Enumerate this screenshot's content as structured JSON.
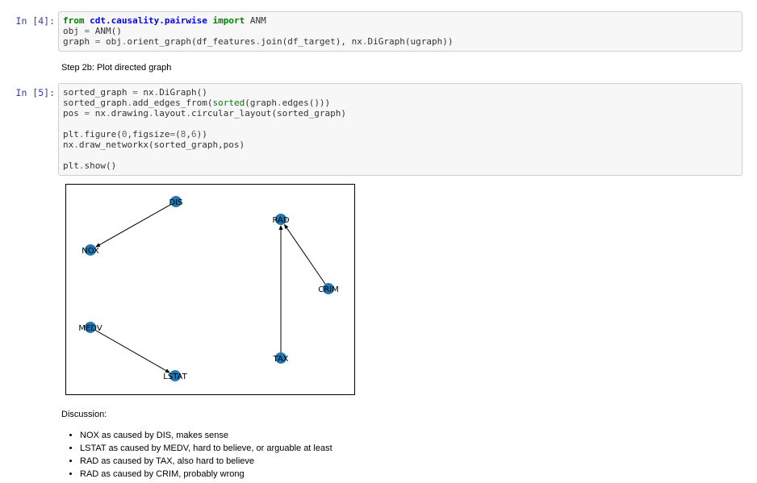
{
  "cells": [
    {
      "prompt": "In [4]:",
      "lines": [
        [
          {
            "t": "from",
            "c": "kw"
          },
          {
            "t": " "
          },
          {
            "t": "cdt.causality.pairwise",
            "c": "ns"
          },
          {
            "t": " "
          },
          {
            "t": "import",
            "c": "kw"
          },
          {
            "t": " ANM"
          }
        ],
        [
          {
            "t": "obj "
          },
          {
            "t": "=",
            "c": "op"
          },
          {
            "t": " ANM()"
          }
        ],
        [
          {
            "t": "graph "
          },
          {
            "t": "=",
            "c": "op"
          },
          {
            "t": " obj"
          },
          {
            "t": ".",
            "c": "op"
          },
          {
            "t": "orient_graph(df_features"
          },
          {
            "t": ".",
            "c": "op"
          },
          {
            "t": "join(df_target), nx"
          },
          {
            "t": ".",
            "c": "op"
          },
          {
            "t": "DiGraph(ugraph))"
          }
        ]
      ]
    },
    {
      "prompt": "In [5]:",
      "lines": [
        [
          {
            "t": "sorted_graph "
          },
          {
            "t": "=",
            "c": "op"
          },
          {
            "t": " nx"
          },
          {
            "t": ".",
            "c": "op"
          },
          {
            "t": "DiGraph()"
          }
        ],
        [
          {
            "t": "sorted_graph"
          },
          {
            "t": ".",
            "c": "op"
          },
          {
            "t": "add_edges_from("
          },
          {
            "t": "sorted",
            "c": "bi"
          },
          {
            "t": "(graph"
          },
          {
            "t": ".",
            "c": "op"
          },
          {
            "t": "edges()))"
          }
        ],
        [
          {
            "t": "pos "
          },
          {
            "t": "=",
            "c": "op"
          },
          {
            "t": " nx"
          },
          {
            "t": ".",
            "c": "op"
          },
          {
            "t": "drawing"
          },
          {
            "t": ".",
            "c": "op"
          },
          {
            "t": "layout"
          },
          {
            "t": ".",
            "c": "op"
          },
          {
            "t": "circular_layout(sorted_graph)"
          }
        ],
        [
          {
            "t": ""
          }
        ],
        [
          {
            "t": "plt"
          },
          {
            "t": ".",
            "c": "op"
          },
          {
            "t": "figure("
          },
          {
            "t": "0",
            "c": "num"
          },
          {
            "t": ",figsize"
          },
          {
            "t": "=",
            "c": "op"
          },
          {
            "t": "("
          },
          {
            "t": "8",
            "c": "num"
          },
          {
            "t": ","
          },
          {
            "t": "6",
            "c": "num"
          },
          {
            "t": "))"
          }
        ],
        [
          {
            "t": "nx"
          },
          {
            "t": ".",
            "c": "op"
          },
          {
            "t": "draw_networkx(sorted_graph,pos)"
          }
        ],
        [
          {
            "t": ""
          }
        ],
        [
          {
            "t": "plt"
          },
          {
            "t": ".",
            "c": "op"
          },
          {
            "t": "show()"
          }
        ]
      ]
    }
  ],
  "step_heading": "Step 2b: Plot directed graph",
  "graph": {
    "node_color": "#1f78b4",
    "nodes": [
      "DIS",
      "NOX",
      "RAD",
      "CRIM",
      "MEDV",
      "LSTAT",
      "TAX"
    ],
    "edges": [
      [
        "DIS",
        "NOX"
      ],
      [
        "CRIM",
        "RAD"
      ],
      [
        "TAX",
        "RAD"
      ],
      [
        "MEDV",
        "LSTAT"
      ]
    ]
  },
  "discussion_title": "Discussion:",
  "discussion_items": [
    "NOX as caused by DIS, makes sense",
    "LSTAT as caused by MEDV, hard to believe, or arguable at least",
    "RAD as caused by TAX, also hard to believe",
    "RAD as caused by CRIM, probably wrong"
  ]
}
